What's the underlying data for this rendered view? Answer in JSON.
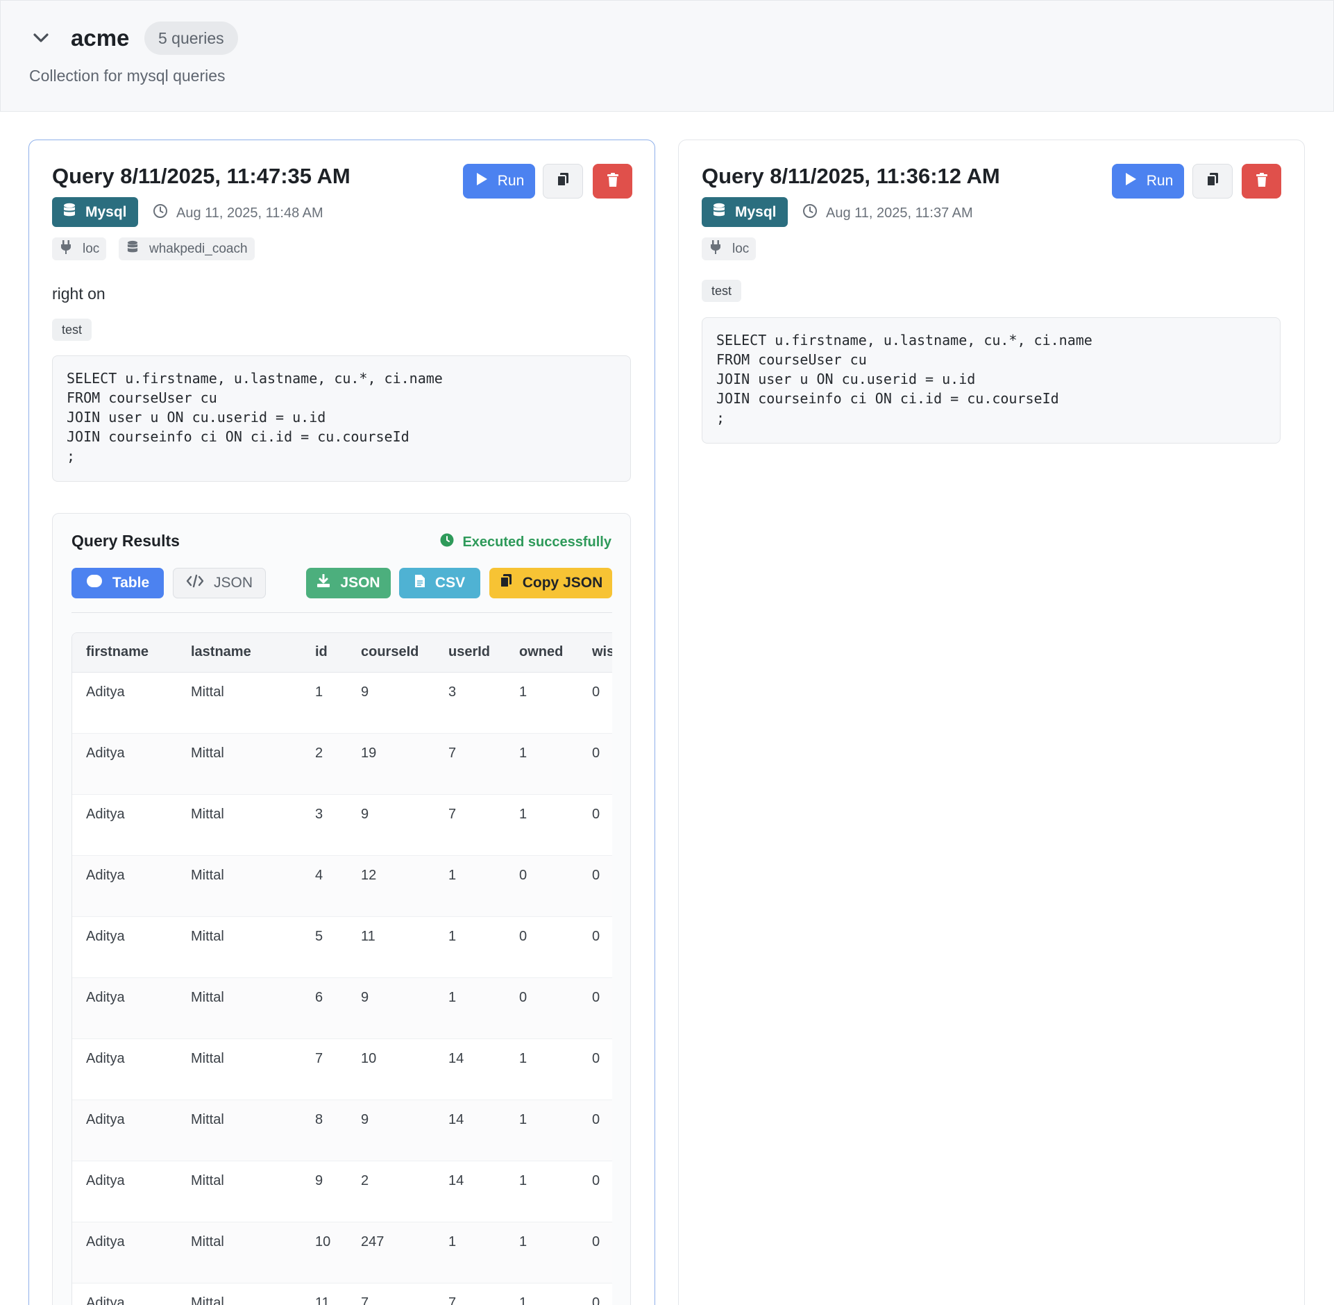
{
  "collection": {
    "name": "acme",
    "count_label": "5 queries",
    "description": "Collection for mysql queries"
  },
  "queries": [
    {
      "title": "Query 8/11/2025, 11:47:35 AM",
      "run_label": "Run",
      "db_label": "Mysql",
      "timestamp": "Aug 11, 2025, 11:48 AM",
      "connection": "loc",
      "database": "whakpedi_coach",
      "description": "right on",
      "tag": "test",
      "sql": "SELECT u.firstname, u.lastname, cu.*, ci.name\nFROM courseUser cu\nJOIN user u ON cu.userid = u.id\nJOIN courseinfo ci ON ci.id = cu.courseId\n;",
      "results": {
        "title": "Query Results",
        "status": "Executed successfully",
        "view_table_label": "Table",
        "view_json_label": "JSON",
        "download_json_label": "JSON",
        "download_csv_label": "CSV",
        "copy_json_label": "Copy JSON",
        "columns": [
          "firstname",
          "lastname",
          "id",
          "courseId",
          "userId",
          "owned",
          "wis"
        ],
        "rows": [
          [
            "Aditya",
            "Mittal",
            "1",
            "9",
            "3",
            "1",
            "0"
          ],
          [
            "Aditya",
            "Mittal",
            "2",
            "19",
            "7",
            "1",
            "0"
          ],
          [
            "Aditya",
            "Mittal",
            "3",
            "9",
            "7",
            "1",
            "0"
          ],
          [
            "Aditya",
            "Mittal",
            "4",
            "12",
            "1",
            "0",
            "0"
          ],
          [
            "Aditya",
            "Mittal",
            "5",
            "11",
            "1",
            "0",
            "0"
          ],
          [
            "Aditya",
            "Mittal",
            "6",
            "9",
            "1",
            "0",
            "0"
          ],
          [
            "Aditya",
            "Mittal",
            "7",
            "10",
            "14",
            "1",
            "0"
          ],
          [
            "Aditya",
            "Mittal",
            "8",
            "9",
            "14",
            "1",
            "0"
          ],
          [
            "Aditya",
            "Mittal",
            "9",
            "2",
            "14",
            "1",
            "0"
          ],
          [
            "Aditya",
            "Mittal",
            "10",
            "247",
            "1",
            "1",
            "0"
          ],
          [
            "Aditya",
            "Mittal",
            "11",
            "7",
            "7",
            "1",
            "0"
          ]
        ]
      }
    },
    {
      "title": "Query 8/11/2025, 11:36:12 AM",
      "run_label": "Run",
      "db_label": "Mysql",
      "timestamp": "Aug 11, 2025, 11:37 AM",
      "connection": "loc",
      "tag": "test",
      "sql": "SELECT u.firstname, u.lastname, cu.*, ci.name\nFROM courseUser cu\nJOIN user u ON cu.userid = u.id\nJOIN courseinfo ci ON ci.id = cu.courseId\n;"
    }
  ],
  "colors": {
    "run": "#4c82f0",
    "delete": "#e0504b",
    "db_badge": "#2b6e7f",
    "success": "#2e9a5a",
    "download_json": "#4caf7d",
    "download_csv": "#4fb2d3",
    "copy_json": "#f7c334"
  },
  "icons": {
    "collapse": "chevron-down-icon",
    "run": "play-icon",
    "copy": "copy-icon",
    "delete": "trash-icon",
    "database": "database-icon",
    "clock": "clock-icon",
    "connection": "plug-icon",
    "status": "check-clock-icon",
    "table_view": "table-icon",
    "json_view": "code-icon",
    "download": "download-icon",
    "csv": "file-icon"
  }
}
